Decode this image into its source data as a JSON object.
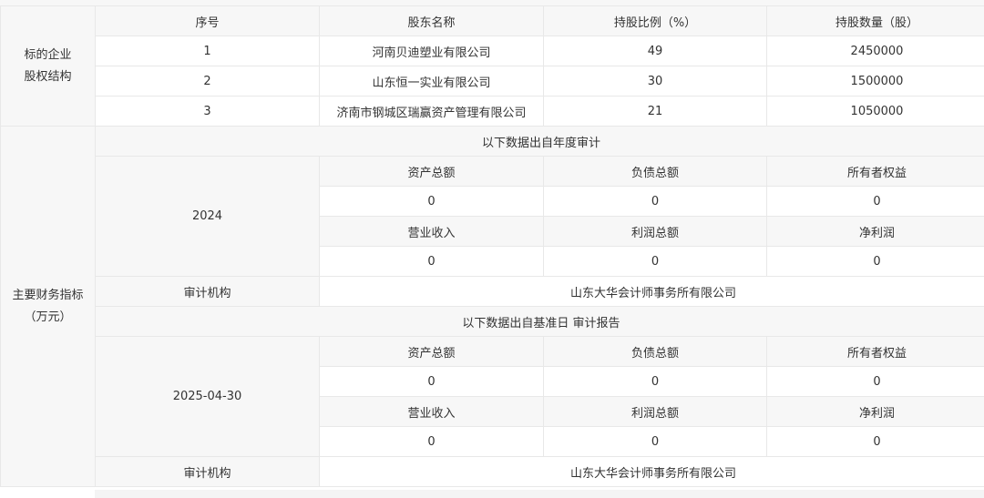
{
  "equity": {
    "label_line1": "标的企业",
    "label_line2": "股权结构",
    "headers": [
      "序号",
      "股东名称",
      "持股比例（%）",
      "持股数量（股）"
    ],
    "rows": [
      [
        "1",
        "河南贝迪塑业有限公司",
        "49",
        "2450000"
      ],
      [
        "2",
        "山东恒一实业有限公司",
        "30",
        "1500000"
      ],
      [
        "3",
        "济南市钢城区瑞赢资产管理有限公司",
        "21",
        "1050000"
      ]
    ]
  },
  "finance": {
    "label_line1": "主要财务指标",
    "label_line2": "（万元）",
    "annual": {
      "title": "以下数据出自年度审计",
      "year": "2024",
      "headers1": [
        "资产总额",
        "负债总额",
        "所有者权益"
      ],
      "values1": [
        "0",
        "0",
        "0"
      ],
      "headers2": [
        "营业收入",
        "利润总额",
        "净利润"
      ],
      "values2": [
        "0",
        "0",
        "0"
      ],
      "auditor_label": "审计机构",
      "auditor": "山东大华会计师事务所有限公司"
    },
    "base_date": {
      "title": "以下数据出自基准日 审计报告",
      "date": "2025-04-30",
      "headers1": [
        "资产总额",
        "负债总额",
        "所有者权益"
      ],
      "values1": [
        "0",
        "0",
        "0"
      ],
      "headers2": [
        "营业收入",
        "利润总额",
        "净利润"
      ],
      "values2": [
        "0",
        "0",
        "0"
      ],
      "auditor_label": "审计机构",
      "auditor": "山东大华会计师事务所有限公司"
    }
  }
}
